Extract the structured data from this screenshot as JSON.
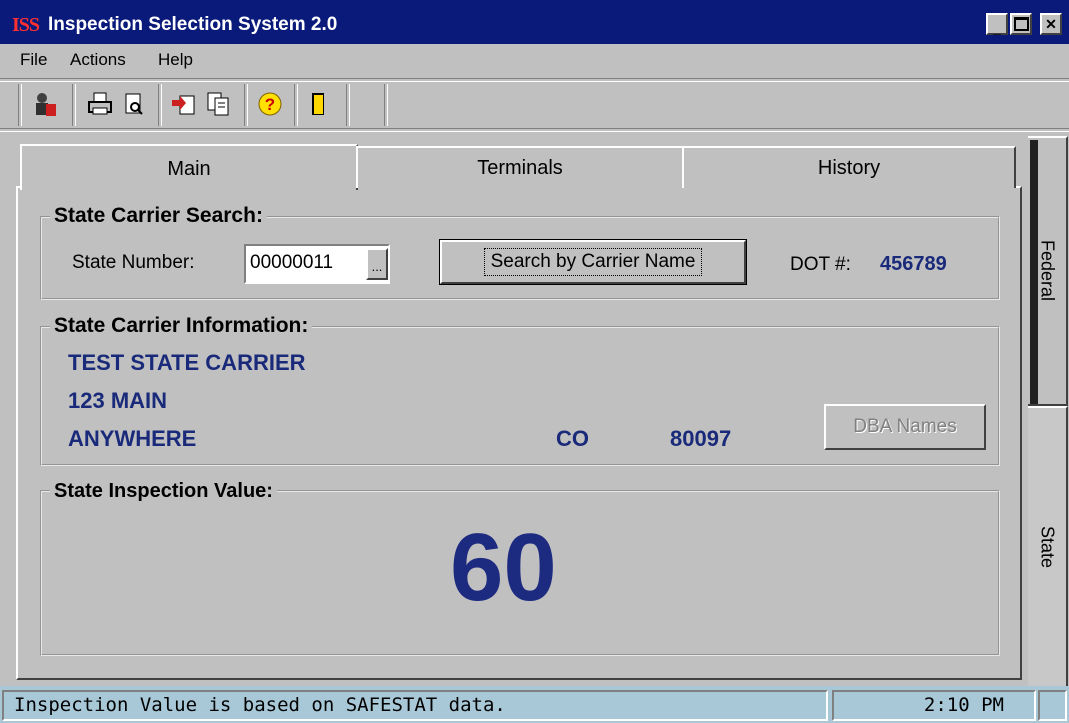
{
  "window": {
    "app_logo": "ISS",
    "title": "Inspection Selection System 2.0"
  },
  "menu": {
    "file": "File",
    "actions": "Actions",
    "help": "Help"
  },
  "tabs": {
    "main": "Main",
    "terminals": "Terminals",
    "history": "History"
  },
  "side_tabs": {
    "federal": "Federal",
    "state": "State"
  },
  "search": {
    "group_label": "State Carrier Search:",
    "state_number_label": "State Number:",
    "state_number_value": "00000011",
    "lookup_button": "...",
    "search_by_name_button": "Search by Carrier Name",
    "dot_label": "DOT #:",
    "dot_value": "456789"
  },
  "carrier_info": {
    "group_label": "State Carrier Information:",
    "name": "TEST STATE CARRIER",
    "address": "123 MAIN",
    "city": "ANYWHERE",
    "state": "CO",
    "zip": "80097",
    "dba_button": "DBA Names"
  },
  "inspection": {
    "group_label": "State Inspection Value:",
    "value": "60"
  },
  "status": {
    "message": "Inspection Value is based on SAFESTAT data.",
    "time": "2:10 PM"
  }
}
